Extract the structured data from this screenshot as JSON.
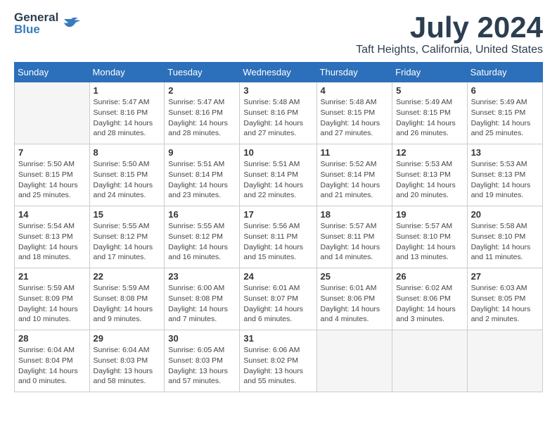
{
  "logo": {
    "general": "General",
    "blue": "Blue"
  },
  "title": "July 2024",
  "location": "Taft Heights, California, United States",
  "days_of_week": [
    "Sunday",
    "Monday",
    "Tuesday",
    "Wednesday",
    "Thursday",
    "Friday",
    "Saturday"
  ],
  "weeks": [
    [
      {
        "day": "",
        "detail": ""
      },
      {
        "day": "1",
        "detail": "Sunrise: 5:47 AM\nSunset: 8:16 PM\nDaylight: 14 hours\nand 28 minutes."
      },
      {
        "day": "2",
        "detail": "Sunrise: 5:47 AM\nSunset: 8:16 PM\nDaylight: 14 hours\nand 28 minutes."
      },
      {
        "day": "3",
        "detail": "Sunrise: 5:48 AM\nSunset: 8:16 PM\nDaylight: 14 hours\nand 27 minutes."
      },
      {
        "day": "4",
        "detail": "Sunrise: 5:48 AM\nSunset: 8:15 PM\nDaylight: 14 hours\nand 27 minutes."
      },
      {
        "day": "5",
        "detail": "Sunrise: 5:49 AM\nSunset: 8:15 PM\nDaylight: 14 hours\nand 26 minutes."
      },
      {
        "day": "6",
        "detail": "Sunrise: 5:49 AM\nSunset: 8:15 PM\nDaylight: 14 hours\nand 25 minutes."
      }
    ],
    [
      {
        "day": "7",
        "detail": ""
      },
      {
        "day": "8",
        "detail": "Sunrise: 5:50 AM\nSunset: 8:15 PM\nDaylight: 14 hours\nand 24 minutes."
      },
      {
        "day": "9",
        "detail": "Sunrise: 5:51 AM\nSunset: 8:14 PM\nDaylight: 14 hours\nand 23 minutes."
      },
      {
        "day": "10",
        "detail": "Sunrise: 5:51 AM\nSunset: 8:14 PM\nDaylight: 14 hours\nand 22 minutes."
      },
      {
        "day": "11",
        "detail": "Sunrise: 5:52 AM\nSunset: 8:14 PM\nDaylight: 14 hours\nand 21 minutes."
      },
      {
        "day": "12",
        "detail": "Sunrise: 5:53 AM\nSunset: 8:13 PM\nDaylight: 14 hours\nand 20 minutes."
      },
      {
        "day": "13",
        "detail": "Sunrise: 5:53 AM\nSunset: 8:13 PM\nDaylight: 14 hours\nand 19 minutes."
      }
    ],
    [
      {
        "day": "14",
        "detail": ""
      },
      {
        "day": "15",
        "detail": "Sunrise: 5:55 AM\nSunset: 8:12 PM\nDaylight: 14 hours\nand 17 minutes."
      },
      {
        "day": "16",
        "detail": "Sunrise: 5:55 AM\nSunset: 8:12 PM\nDaylight: 14 hours\nand 16 minutes."
      },
      {
        "day": "17",
        "detail": "Sunrise: 5:56 AM\nSunset: 8:11 PM\nDaylight: 14 hours\nand 15 minutes."
      },
      {
        "day": "18",
        "detail": "Sunrise: 5:57 AM\nSunset: 8:11 PM\nDaylight: 14 hours\nand 14 minutes."
      },
      {
        "day": "19",
        "detail": "Sunrise: 5:57 AM\nSunset: 8:10 PM\nDaylight: 14 hours\nand 13 minutes."
      },
      {
        "day": "20",
        "detail": "Sunrise: 5:58 AM\nSunset: 8:10 PM\nDaylight: 14 hours\nand 11 minutes."
      }
    ],
    [
      {
        "day": "21",
        "detail": ""
      },
      {
        "day": "22",
        "detail": "Sunrise: 5:59 AM\nSunset: 8:08 PM\nDaylight: 14 hours\nand 9 minutes."
      },
      {
        "day": "23",
        "detail": "Sunrise: 6:00 AM\nSunset: 8:08 PM\nDaylight: 14 hours\nand 7 minutes."
      },
      {
        "day": "24",
        "detail": "Sunrise: 6:01 AM\nSunset: 8:07 PM\nDaylight: 14 hours\nand 6 minutes."
      },
      {
        "day": "25",
        "detail": "Sunrise: 6:01 AM\nSunset: 8:06 PM\nDaylight: 14 hours\nand 4 minutes."
      },
      {
        "day": "26",
        "detail": "Sunrise: 6:02 AM\nSunset: 8:06 PM\nDaylight: 14 hours\nand 3 minutes."
      },
      {
        "day": "27",
        "detail": "Sunrise: 6:03 AM\nSunset: 8:05 PM\nDaylight: 14 hours\nand 2 minutes."
      }
    ],
    [
      {
        "day": "28",
        "detail": "Sunrise: 6:04 AM\nSunset: 8:04 PM\nDaylight: 14 hours\nand 0 minutes."
      },
      {
        "day": "29",
        "detail": "Sunrise: 6:04 AM\nSunset: 8:03 PM\nDaylight: 13 hours\nand 58 minutes."
      },
      {
        "day": "30",
        "detail": "Sunrise: 6:05 AM\nSunset: 8:03 PM\nDaylight: 13 hours\nand 57 minutes."
      },
      {
        "day": "31",
        "detail": "Sunrise: 6:06 AM\nSunset: 8:02 PM\nDaylight: 13 hours\nand 55 minutes."
      },
      {
        "day": "",
        "detail": ""
      },
      {
        "day": "",
        "detail": ""
      },
      {
        "day": "",
        "detail": ""
      }
    ]
  ],
  "week0_sunday": "Sunrise: 5:50 AM\nSunset: 8:15 PM\nDaylight: 14 hours\nand 25 minutes.",
  "week2_sunday": "Sunrise: 5:54 AM\nSunset: 8:13 PM\nDaylight: 14 hours\nand 18 minutes.",
  "week3_sunday": "Sunrise: 5:59 AM\nSunset: 8:09 PM\nDaylight: 14 hours\nand 10 minutes."
}
